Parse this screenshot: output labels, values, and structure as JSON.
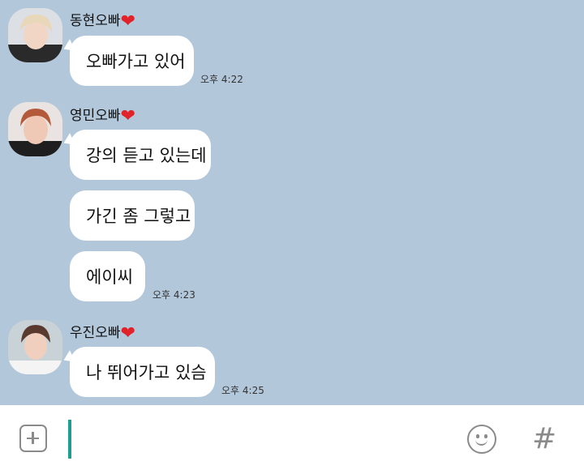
{
  "messages": [
    {
      "sender": "동현오빠",
      "heart": "❤",
      "bubbles": [
        "오빠가고 있어"
      ],
      "time": "오후 4:22"
    },
    {
      "sender": "영민오빠",
      "heart": "❤",
      "bubbles": [
        "강의 듣고 있는데",
        "가긴 좀 그렇고",
        "에이씨"
      ],
      "time": "오후 4:23"
    },
    {
      "sender": "우진오빠",
      "heart": "❤",
      "bubbles": [
        "나 뛰어가고 있슴"
      ],
      "time": "오후 4:25"
    }
  ],
  "composer": {
    "add_icon": "plus-square-icon",
    "emoji_icon": "smiley-icon",
    "hash_label": "#"
  },
  "colors": {
    "chat_background": "#b2c7da",
    "bubble": "#ffffff",
    "caret": "#1f9d8f",
    "heart": "#e0232a"
  }
}
